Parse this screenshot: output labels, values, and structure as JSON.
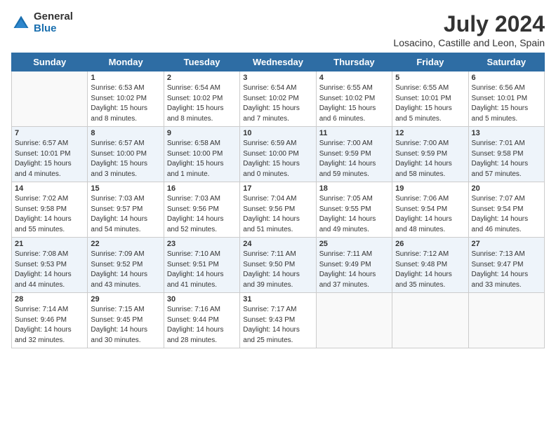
{
  "header": {
    "logo_general": "General",
    "logo_blue": "Blue",
    "month_year": "July 2024",
    "location": "Losacino, Castille and Leon, Spain"
  },
  "weekdays": [
    "Sunday",
    "Monday",
    "Tuesday",
    "Wednesday",
    "Thursday",
    "Friday",
    "Saturday"
  ],
  "weeks": [
    [
      {
        "day": "",
        "empty": true
      },
      {
        "day": "1",
        "sunrise": "Sunrise: 6:53 AM",
        "sunset": "Sunset: 10:02 PM",
        "daylight": "Daylight: 15 hours and 8 minutes."
      },
      {
        "day": "2",
        "sunrise": "Sunrise: 6:54 AM",
        "sunset": "Sunset: 10:02 PM",
        "daylight": "Daylight: 15 hours and 8 minutes."
      },
      {
        "day": "3",
        "sunrise": "Sunrise: 6:54 AM",
        "sunset": "Sunset: 10:02 PM",
        "daylight": "Daylight: 15 hours and 7 minutes."
      },
      {
        "day": "4",
        "sunrise": "Sunrise: 6:55 AM",
        "sunset": "Sunset: 10:02 PM",
        "daylight": "Daylight: 15 hours and 6 minutes."
      },
      {
        "day": "5",
        "sunrise": "Sunrise: 6:55 AM",
        "sunset": "Sunset: 10:01 PM",
        "daylight": "Daylight: 15 hours and 5 minutes."
      },
      {
        "day": "6",
        "sunrise": "Sunrise: 6:56 AM",
        "sunset": "Sunset: 10:01 PM",
        "daylight": "Daylight: 15 hours and 5 minutes."
      }
    ],
    [
      {
        "day": "7",
        "sunrise": "Sunrise: 6:57 AM",
        "sunset": "Sunset: 10:01 PM",
        "daylight": "Daylight: 15 hours and 4 minutes."
      },
      {
        "day": "8",
        "sunrise": "Sunrise: 6:57 AM",
        "sunset": "Sunset: 10:00 PM",
        "daylight": "Daylight: 15 hours and 3 minutes."
      },
      {
        "day": "9",
        "sunrise": "Sunrise: 6:58 AM",
        "sunset": "Sunset: 10:00 PM",
        "daylight": "Daylight: 15 hours and 1 minute."
      },
      {
        "day": "10",
        "sunrise": "Sunrise: 6:59 AM",
        "sunset": "Sunset: 10:00 PM",
        "daylight": "Daylight: 15 hours and 0 minutes."
      },
      {
        "day": "11",
        "sunrise": "Sunrise: 7:00 AM",
        "sunset": "Sunset: 9:59 PM",
        "daylight": "Daylight: 14 hours and 59 minutes."
      },
      {
        "day": "12",
        "sunrise": "Sunrise: 7:00 AM",
        "sunset": "Sunset: 9:59 PM",
        "daylight": "Daylight: 14 hours and 58 minutes."
      },
      {
        "day": "13",
        "sunrise": "Sunrise: 7:01 AM",
        "sunset": "Sunset: 9:58 PM",
        "daylight": "Daylight: 14 hours and 57 minutes."
      }
    ],
    [
      {
        "day": "14",
        "sunrise": "Sunrise: 7:02 AM",
        "sunset": "Sunset: 9:58 PM",
        "daylight": "Daylight: 14 hours and 55 minutes."
      },
      {
        "day": "15",
        "sunrise": "Sunrise: 7:03 AM",
        "sunset": "Sunset: 9:57 PM",
        "daylight": "Daylight: 14 hours and 54 minutes."
      },
      {
        "day": "16",
        "sunrise": "Sunrise: 7:03 AM",
        "sunset": "Sunset: 9:56 PM",
        "daylight": "Daylight: 14 hours and 52 minutes."
      },
      {
        "day": "17",
        "sunrise": "Sunrise: 7:04 AM",
        "sunset": "Sunset: 9:56 PM",
        "daylight": "Daylight: 14 hours and 51 minutes."
      },
      {
        "day": "18",
        "sunrise": "Sunrise: 7:05 AM",
        "sunset": "Sunset: 9:55 PM",
        "daylight": "Daylight: 14 hours and 49 minutes."
      },
      {
        "day": "19",
        "sunrise": "Sunrise: 7:06 AM",
        "sunset": "Sunset: 9:54 PM",
        "daylight": "Daylight: 14 hours and 48 minutes."
      },
      {
        "day": "20",
        "sunrise": "Sunrise: 7:07 AM",
        "sunset": "Sunset: 9:54 PM",
        "daylight": "Daylight: 14 hours and 46 minutes."
      }
    ],
    [
      {
        "day": "21",
        "sunrise": "Sunrise: 7:08 AM",
        "sunset": "Sunset: 9:53 PM",
        "daylight": "Daylight: 14 hours and 44 minutes."
      },
      {
        "day": "22",
        "sunrise": "Sunrise: 7:09 AM",
        "sunset": "Sunset: 9:52 PM",
        "daylight": "Daylight: 14 hours and 43 minutes."
      },
      {
        "day": "23",
        "sunrise": "Sunrise: 7:10 AM",
        "sunset": "Sunset: 9:51 PM",
        "daylight": "Daylight: 14 hours and 41 minutes."
      },
      {
        "day": "24",
        "sunrise": "Sunrise: 7:11 AM",
        "sunset": "Sunset: 9:50 PM",
        "daylight": "Daylight: 14 hours and 39 minutes."
      },
      {
        "day": "25",
        "sunrise": "Sunrise: 7:11 AM",
        "sunset": "Sunset: 9:49 PM",
        "daylight": "Daylight: 14 hours and 37 minutes."
      },
      {
        "day": "26",
        "sunrise": "Sunrise: 7:12 AM",
        "sunset": "Sunset: 9:48 PM",
        "daylight": "Daylight: 14 hours and 35 minutes."
      },
      {
        "day": "27",
        "sunrise": "Sunrise: 7:13 AM",
        "sunset": "Sunset: 9:47 PM",
        "daylight": "Daylight: 14 hours and 33 minutes."
      }
    ],
    [
      {
        "day": "28",
        "sunrise": "Sunrise: 7:14 AM",
        "sunset": "Sunset: 9:46 PM",
        "daylight": "Daylight: 14 hours and 32 minutes."
      },
      {
        "day": "29",
        "sunrise": "Sunrise: 7:15 AM",
        "sunset": "Sunset: 9:45 PM",
        "daylight": "Daylight: 14 hours and 30 minutes."
      },
      {
        "day": "30",
        "sunrise": "Sunrise: 7:16 AM",
        "sunset": "Sunset: 9:44 PM",
        "daylight": "Daylight: 14 hours and 28 minutes."
      },
      {
        "day": "31",
        "sunrise": "Sunrise: 7:17 AM",
        "sunset": "Sunset: 9:43 PM",
        "daylight": "Daylight: 14 hours and 25 minutes."
      },
      {
        "day": "",
        "empty": true
      },
      {
        "day": "",
        "empty": true
      },
      {
        "day": "",
        "empty": true
      }
    ]
  ]
}
